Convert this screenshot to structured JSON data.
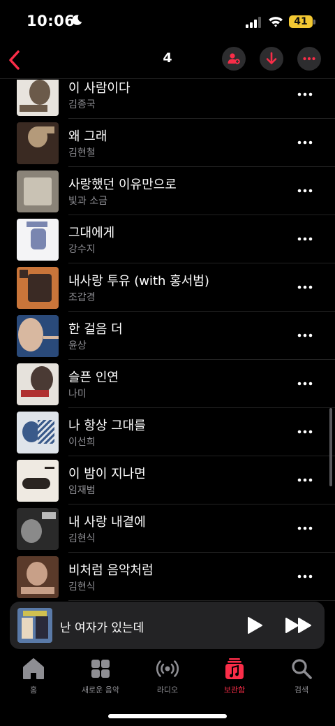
{
  "status_bar": {
    "time": "10:06",
    "battery": "41"
  },
  "nav": {
    "title": "4"
  },
  "songs": [
    {
      "title": "이 사람이다",
      "artist": "김종국",
      "art_bg": "#e8e4de",
      "art_fg": "#6b5a4a"
    },
    {
      "title": "왜 그래",
      "artist": "김현철",
      "art_bg": "#3a2a22",
      "art_fg": "#b49a7a"
    },
    {
      "title": "사랑했던 이유만으로",
      "artist": "빛과 소금",
      "art_bg": "#8a8378",
      "art_fg": "#c9c2b4"
    },
    {
      "title": "그대에게",
      "artist": "강수지",
      "art_bg": "#f4f4f6",
      "art_fg": "#7a86b0"
    },
    {
      "title": "내사랑 투유 (with 홍서범)",
      "artist": "조갑경",
      "art_bg": "#c9753a",
      "art_fg": "#3a2a24"
    },
    {
      "title": "한 걸음 더",
      "artist": "윤상",
      "art_bg": "#2a4a7a",
      "art_fg": "#d8b8a0"
    },
    {
      "title": "슬픈 인연",
      "artist": "나미",
      "art_bg": "#e6e2dc",
      "art_fg": "#4a3a34"
    },
    {
      "title": "나 항상 그대를",
      "artist": "이선희",
      "art_bg": "#dfe4ea",
      "art_fg": "#3a5a8a"
    },
    {
      "title": "이 밤이 지나면",
      "artist": "임재범",
      "art_bg": "#efeae2",
      "art_fg": "#2a2420"
    },
    {
      "title": "내 사랑 내곁에",
      "artist": "김현식",
      "art_bg": "#2a2a2a",
      "art_fg": "#8a8a8a"
    },
    {
      "title": "비처럼 음악처럼",
      "artist": "김현식",
      "art_bg": "#5a3a2a",
      "art_fg": "#c8a088"
    }
  ],
  "mini_player": {
    "title": "난 여자가 있는데"
  },
  "tabs": [
    {
      "label": "홈",
      "icon": "home-icon"
    },
    {
      "label": "새로운 음악",
      "icon": "grid-icon"
    },
    {
      "label": "라디오",
      "icon": "radio-icon"
    },
    {
      "label": "보관함",
      "icon": "library-icon"
    },
    {
      "label": "검색",
      "icon": "search-icon"
    }
  ],
  "colors": {
    "accent": "#fa2d48",
    "background": "#000000",
    "secondary_text": "#8e8e93"
  }
}
